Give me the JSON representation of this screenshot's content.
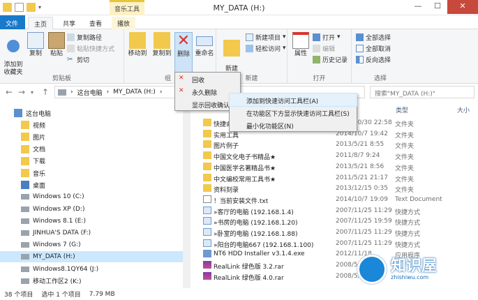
{
  "window": {
    "title": "MY_DATA (H:)",
    "context_tab_label": "音乐工具",
    "minimize": "—",
    "maximize": "☐",
    "close": "✕"
  },
  "ribbon_tabs": [
    "文件",
    "主页",
    "共享",
    "查看",
    "播放"
  ],
  "ribbon": {
    "clipboard": {
      "pin": "添加到\n收藏夹",
      "copy": "复制",
      "paste": "粘贴",
      "copy_path": "复制路径",
      "paste_shortcut": "粘贴快捷方式",
      "cut": "剪切",
      "label": "剪贴板"
    },
    "organize": {
      "move_to": "移动到",
      "copy_to": "复制到",
      "delete": "删除",
      "rename": "重命名",
      "label": "组"
    },
    "new": {
      "new_folder": "新建\n文件夹",
      "new_item": "新建项目",
      "easy_access": "轻松访问",
      "label": "新建"
    },
    "open": {
      "properties": "属性",
      "open": "打开",
      "edit": "编辑",
      "history": "历史记录",
      "label": "打开"
    },
    "select": {
      "select_all": "全部选择",
      "select_none": "全部取消",
      "invert": "反向选择",
      "label": "选择"
    }
  },
  "address": {
    "crumbs": [
      "这台电脑",
      "MY_DATA (H:)"
    ],
    "search_placeholder": "搜索\"MY_DATA (H:)\""
  },
  "nav_pane": [
    {
      "label": "这台电脑",
      "icon": "computer-icon"
    },
    {
      "label": "视频",
      "icon": "video-folder-icon"
    },
    {
      "label": "图片",
      "icon": "picture-folder-icon"
    },
    {
      "label": "文档",
      "icon": "document-folder-icon"
    },
    {
      "label": "下载",
      "icon": "download-folder-icon"
    },
    {
      "label": "音乐",
      "icon": "music-folder-icon"
    },
    {
      "label": "桌面",
      "icon": "desktop-folder-icon"
    },
    {
      "label": "Windows 10 (C:)",
      "icon": "drive-icon"
    },
    {
      "label": "Windows XP (D:)",
      "icon": "drive-icon"
    },
    {
      "label": "Windows 8.1 (E:)",
      "icon": "drive-icon"
    },
    {
      "label": "JINHUA'S DATA (F:)",
      "icon": "drive-icon"
    },
    {
      "label": "Windows 7 (G:)",
      "icon": "drive-icon"
    },
    {
      "label": "MY_DATA (H:)",
      "icon": "drive-icon"
    },
    {
      "label": "Windows8.1QY64 (J:)",
      "icon": "drive-icon"
    },
    {
      "label": "移动工作区2 (K:)",
      "icon": "drive-icon"
    }
  ],
  "columns": {
    "type": "类型",
    "size": "大小"
  },
  "files": [
    {
      "name": "快捷命",
      "date": "2014/10/30 22:58",
      "type": "文件夹",
      "icon": "folder-icon"
    },
    {
      "name": "实用工具",
      "date": "2014/10/7 19:42",
      "type": "文件夹",
      "icon": "folder-icon"
    },
    {
      "name": "图片例子",
      "date": "2013/5/21 8:55",
      "type": "文件夹",
      "icon": "folder-icon"
    },
    {
      "name": "中国文化电子书精品★",
      "date": "2011/8/7 9:24",
      "type": "文件夹",
      "icon": "folder-icon"
    },
    {
      "name": "中国医学名著精品书★",
      "date": "2013/5/21 8:56",
      "type": "文件夹",
      "icon": "folder-icon"
    },
    {
      "name": "中文编校常用工具书★",
      "date": "2011/5/21 21:17",
      "type": "文件夹",
      "icon": "folder-icon"
    },
    {
      "name": "资料刻录",
      "date": "2013/12/15 0:35",
      "type": "文件夹",
      "icon": "folder-icon"
    },
    {
      "name": "！当前安装文件.txt",
      "date": "2014/10/7 19:09",
      "type": "Text Document",
      "icon": "text-file-icon"
    },
    {
      "name": "»客厅的电脑 (192.168.1.4)",
      "date": "2007/11/25 11:29",
      "type": "快捷方式",
      "icon": "shortcut-icon"
    },
    {
      "name": "»书房的电脑 (192.168.1.20)",
      "date": "2007/11/25 19:59",
      "type": "快捷方式",
      "icon": "shortcut-icon"
    },
    {
      "name": "»卧室的电脑 (192.168.1.88)",
      "date": "2007/11/25 11:29",
      "type": "快捷方式",
      "icon": "shortcut-icon"
    },
    {
      "name": "»阳台的电脑667 (192.168.1.100)",
      "date": "2007/11/25 11:29",
      "type": "快捷方式",
      "icon": "shortcut-icon"
    },
    {
      "name": "NT6 HDD Installer v3.1.4.exe",
      "date": "2012/11/18",
      "type": "应用程序",
      "icon": "exe-icon"
    },
    {
      "name": "RealLink 绿色版 3.2.rar",
      "date": "2008/5/",
      "type": "",
      "icon": "rar-icon"
    },
    {
      "name": "RealLink 绿色版 4.0.rar",
      "date": "2008/5/",
      "type": "",
      "icon": "rar-icon"
    }
  ],
  "delete_menu": [
    "回收",
    "永久删除",
    "显示回收确认"
  ],
  "qat_menu": [
    "添加到快速访问工具栏(A)",
    "在功能区下方显示快速访问工具栏(S)",
    "最小化功能区(N)"
  ],
  "status": {
    "count": "38 个项目",
    "selection": "选中 1 个项目",
    "size": "7.79 MB"
  },
  "watermark": {
    "title": "知识屋",
    "url": "zhishiwu.com"
  },
  "colors": {
    "accent": "#1979ca",
    "folder": "#f2c94c",
    "delete_red": "#d9342b",
    "selection": "#cce8ff",
    "context_tab": "#fdf2c7"
  }
}
